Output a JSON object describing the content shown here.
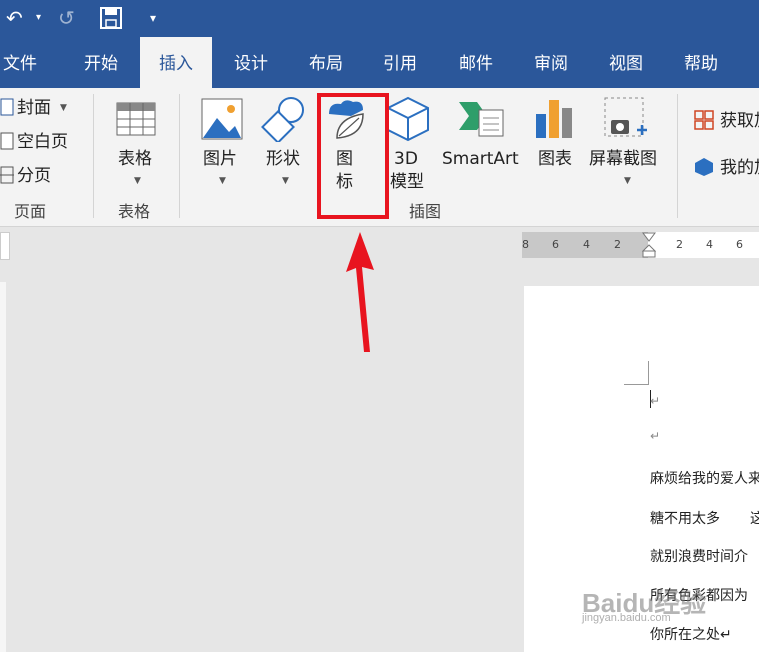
{
  "quick_access": {
    "undo": "↶",
    "redo": "↺",
    "save": "💾",
    "more": "▾"
  },
  "tabs": [
    "文件",
    "开始",
    "插入",
    "设计",
    "布局",
    "引用",
    "邮件",
    "审阅",
    "视图",
    "帮助"
  ],
  "active_tab": "插入",
  "ribbon": {
    "pages_group": {
      "cover": "封面",
      "blank": "空白页",
      "break": "分页",
      "label": "页面"
    },
    "table_group": {
      "button": "表格",
      "label": "表格"
    },
    "illustrations": {
      "picture": "图片",
      "shapes": "形状",
      "icon_l1": "图",
      "icon_l2": "标",
      "model_l1": "3D",
      "model_l2": "模型",
      "smartart": "SmartArt",
      "chart": "图表",
      "screenshot": "屏幕截图",
      "label": "插图"
    },
    "addins": {
      "get": "获取加",
      "my": "我的加"
    }
  },
  "ruler": [
    "8",
    "6",
    "4",
    "2",
    "2",
    "4",
    "6"
  ],
  "doc_lines": [
    "麻烦给我的爱人来",
    "糖不用太多",
    "就别浪费时间介",
    "所有色彩都因为",
    "你所在之处↵"
  ],
  "doc_line2_extra": "这",
  "watermark": {
    "brand": "Baidu经验",
    "url": "jingyan.baidu.com"
  },
  "colors": {
    "titlebar": "#2b579a",
    "highlight": "#e8141f"
  }
}
